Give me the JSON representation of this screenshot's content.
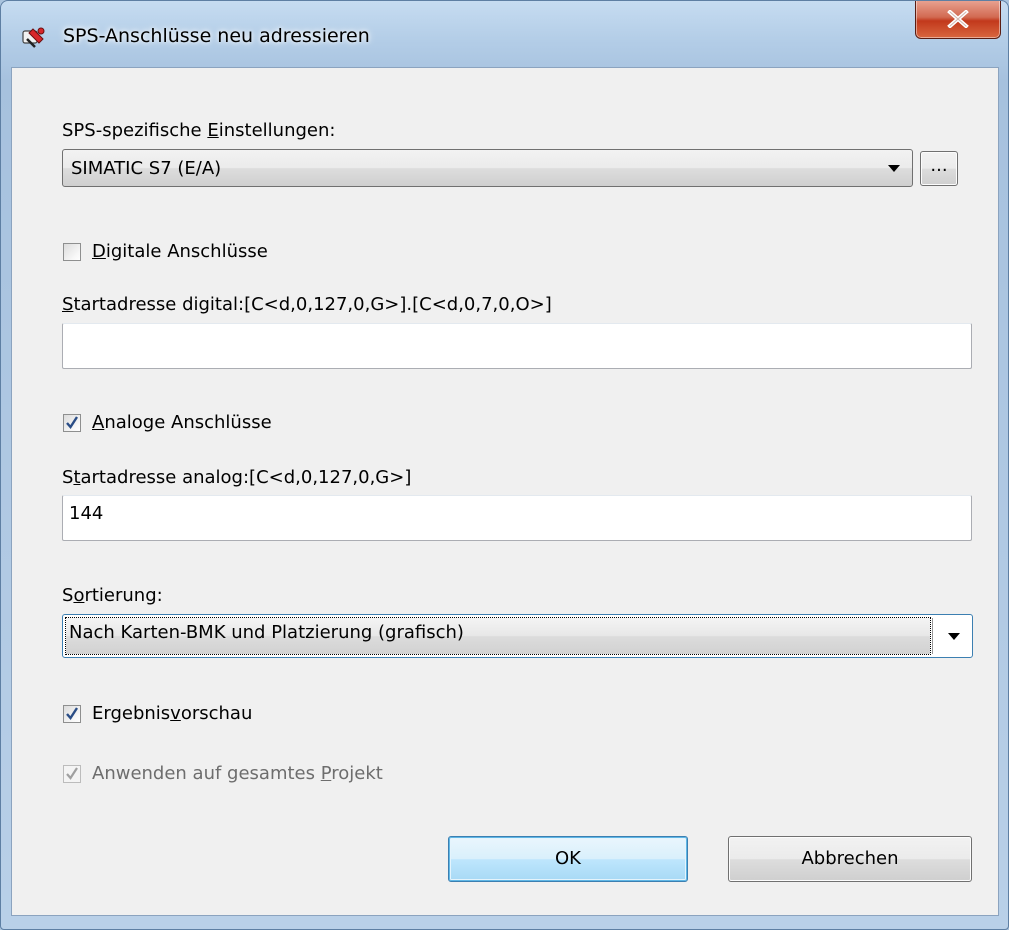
{
  "window": {
    "title": "SPS-Anschlüsse neu adressieren",
    "close_icon": "close-icon",
    "app_icon": "plc-connect-icon"
  },
  "plc_settings": {
    "label_before": "SPS-spezifische ",
    "label_mnemonic": "E",
    "label_after": "instellungen:",
    "selected": "SIMATIC S7 (E/A)",
    "browse_label": "..."
  },
  "digital": {
    "checkbox_mnemonic": "D",
    "checkbox_rest": "igitale Anschlüsse",
    "checked": false,
    "address_mnemonic": "S",
    "address_rest": "tartadresse digital:[C<d,0,127,0,G>].[C<d,0,7,0,O>]",
    "value": ""
  },
  "analog": {
    "checkbox_mnemonic": "A",
    "checkbox_rest": "naloge Anschlüsse",
    "checked": true,
    "address_before": "S",
    "address_mnemonic": "t",
    "address_rest": "artadresse analog:[C<d,0,127,0,G>]",
    "value": "144"
  },
  "sorting": {
    "label_before": "S",
    "label_mnemonic": "o",
    "label_after": "rtierung:",
    "selected": "Nach Karten-BMK und Platzierung (grafisch)"
  },
  "preview": {
    "label_before": "Ergebnis",
    "label_mnemonic": "v",
    "label_after": "orschau",
    "checked": true
  },
  "apply_project": {
    "label_before": "Anwenden auf gesamtes ",
    "label_mnemonic": "P",
    "label_after": "rojekt",
    "checked": true,
    "enabled": false
  },
  "buttons": {
    "ok": "OK",
    "cancel": "Abbrechen"
  },
  "colors": {
    "accent": "#3c7fb1",
    "checkmark": "#2a4d86",
    "close_red": "#c2391c"
  }
}
